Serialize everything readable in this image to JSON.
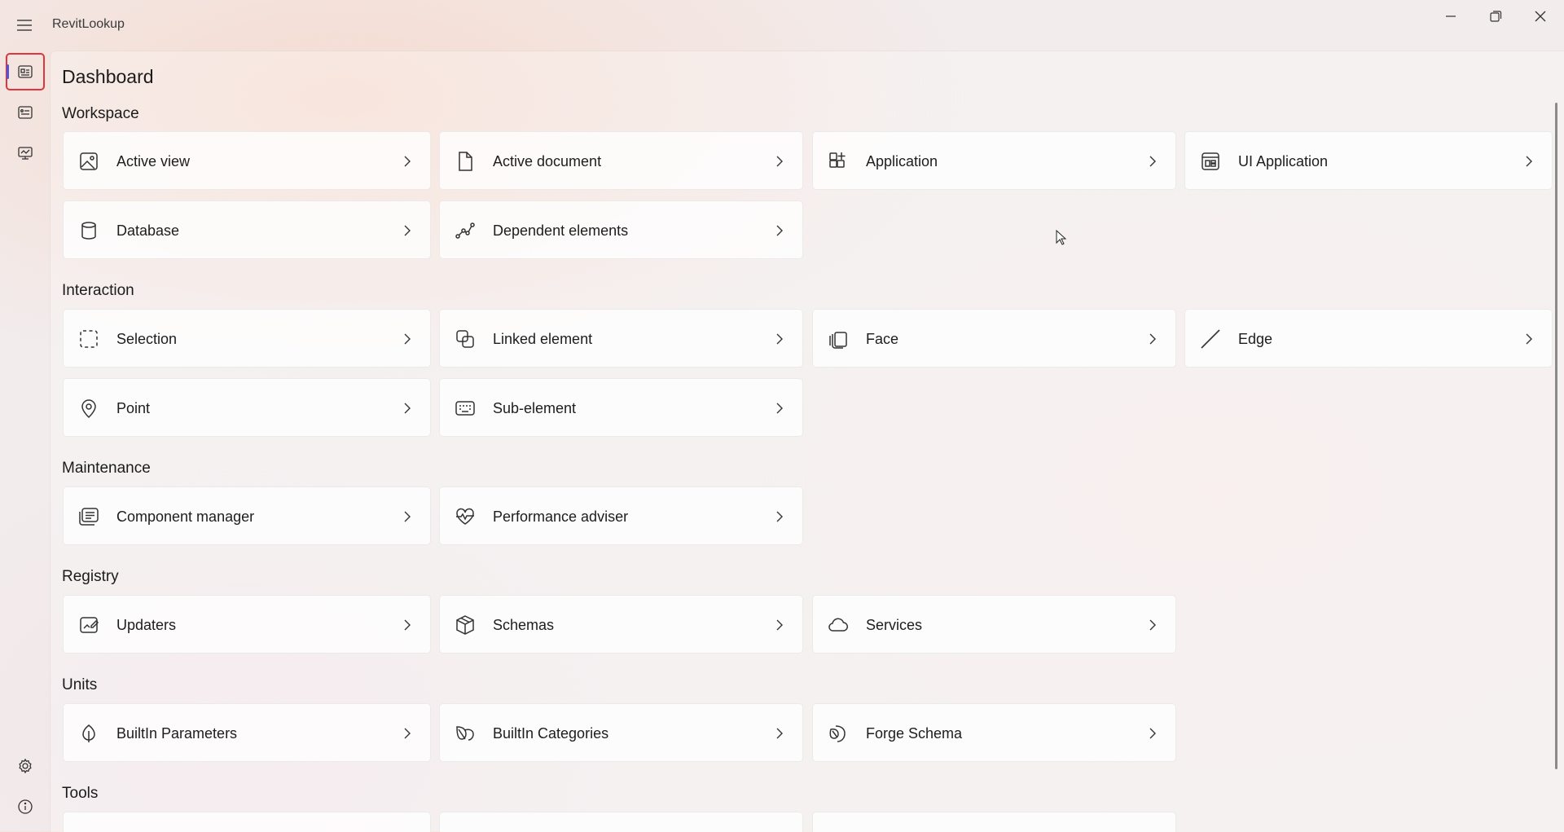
{
  "app": {
    "title": "RevitLookup"
  },
  "window_controls": [
    "minimize-icon",
    "restore-icon",
    "close-icon"
  ],
  "rail": {
    "top_items": [
      "dashboard-icon",
      "events-icon",
      "monitor-icon"
    ],
    "bottom_items": [
      "gear-icon",
      "info-icon"
    ],
    "active": "dashboard"
  },
  "page": {
    "title": "Dashboard"
  },
  "sections": {
    "workspace": {
      "title": "Workspace",
      "cards": [
        {
          "label": "Active view",
          "icon": "image-icon"
        },
        {
          "label": "Active document",
          "icon": "document-icon"
        },
        {
          "label": "Application",
          "icon": "apps-add-icon"
        },
        {
          "label": "UI Application",
          "icon": "window-apps-icon"
        },
        {
          "label": "Database",
          "icon": "database-icon"
        },
        {
          "label": "Dependent elements",
          "icon": "data-line-icon"
        }
      ]
    },
    "interaction": {
      "title": "Interaction",
      "cards": [
        {
          "label": "Selection",
          "icon": "selection-icon"
        },
        {
          "label": "Linked element",
          "icon": "link-squares-icon"
        },
        {
          "label": "Face",
          "icon": "face-layers-icon"
        },
        {
          "label": "Edge",
          "icon": "line-icon"
        },
        {
          "label": "Point",
          "icon": "location-pin-icon"
        },
        {
          "label": "Sub-element",
          "icon": "keyboard-icon"
        }
      ]
    },
    "maintenance": {
      "title": "Maintenance",
      "cards": [
        {
          "label": "Component manager",
          "icon": "text-list-icon"
        },
        {
          "label": "Performance adviser",
          "icon": "heart-pulse-icon"
        }
      ]
    },
    "registry": {
      "title": "Registry",
      "cards": [
        {
          "label": "Updaters",
          "icon": "image-edit-icon"
        },
        {
          "label": "Schemas",
          "icon": "cube-icon"
        },
        {
          "label": "Services",
          "icon": "cloud-icon"
        }
      ]
    },
    "units": {
      "title": "Units",
      "cards": [
        {
          "label": "BuiltIn Parameters",
          "icon": "leaf-icon"
        },
        {
          "label": "BuiltIn Categories",
          "icon": "leaf-two-icon"
        },
        {
          "label": "Forge Schema",
          "icon": "leaf-three-icon"
        }
      ]
    },
    "tools": {
      "title": "Tools"
    }
  },
  "colors": {
    "accent": "#5b4fd6",
    "highlight_box": "#e0353c"
  }
}
